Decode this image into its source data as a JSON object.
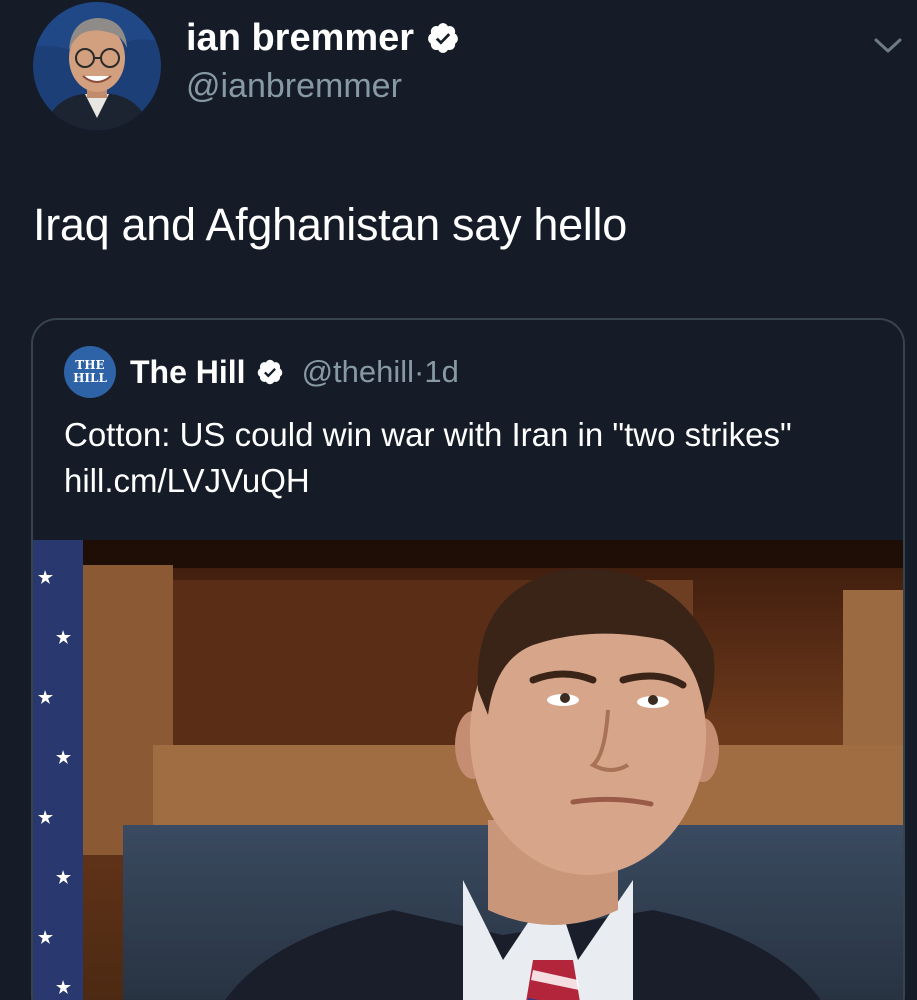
{
  "author": {
    "name": "ian bremmer",
    "handle": "@ianbremmer"
  },
  "tweet": {
    "text": "Iraq and Afghanistan say hello"
  },
  "quoted": {
    "logo_line1": "THE",
    "logo_line2": "HILL",
    "name": "The Hill",
    "handle": "@thehill",
    "separator": "·",
    "time": "1d",
    "text": "Cotton: US could win war with Iran in \"two strikes\"",
    "link": "hill.cm/LVJVuQH"
  },
  "colors": {
    "background": "#151c27",
    "secondary_text": "#8899a6",
    "border": "#38444d",
    "verified_badge": "#ffffff"
  },
  "icons": {
    "verified": "verified-badge-icon",
    "menu": "chevron-down-icon"
  }
}
